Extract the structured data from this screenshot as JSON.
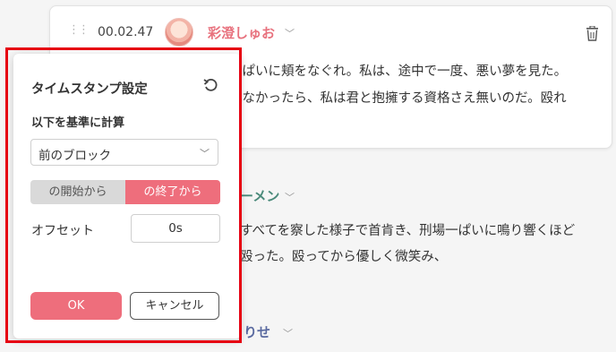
{
  "script_block": {
    "timestamp": "00.02.47",
    "speaker": "彩澄しゅお",
    "lines": [
      "っぱいに頬をなぐれ。私は、途中で一度、悪い夢を見た。",
      "れなかったら、私は君と抱擁する資格さえ無いのだ。殴れ"
    ]
  },
  "background": {
    "speaker2": "ーメン",
    "lines2": [
      "すべてを察した様子で首肯き、刑場一ぱいに鳴り響くほど",
      "殴った。殴ってから優しく微笑み、"
    ],
    "speaker3": "りせ"
  },
  "popup": {
    "title": "タイムスタンプ設定",
    "subtitle": "以下を基準に計算",
    "select_value": "前のブロック",
    "segment_start": "の開始から",
    "segment_end": "の終了から",
    "offset_label": "オフセット",
    "offset_value": "0s",
    "ok_label": "OK",
    "cancel_label": "キャンセル"
  },
  "colors": {
    "accent": "#ee6e7c",
    "highlight": "#e60012",
    "speaker2": "#4a8a7a",
    "speaker3": "#5a6aa0"
  }
}
